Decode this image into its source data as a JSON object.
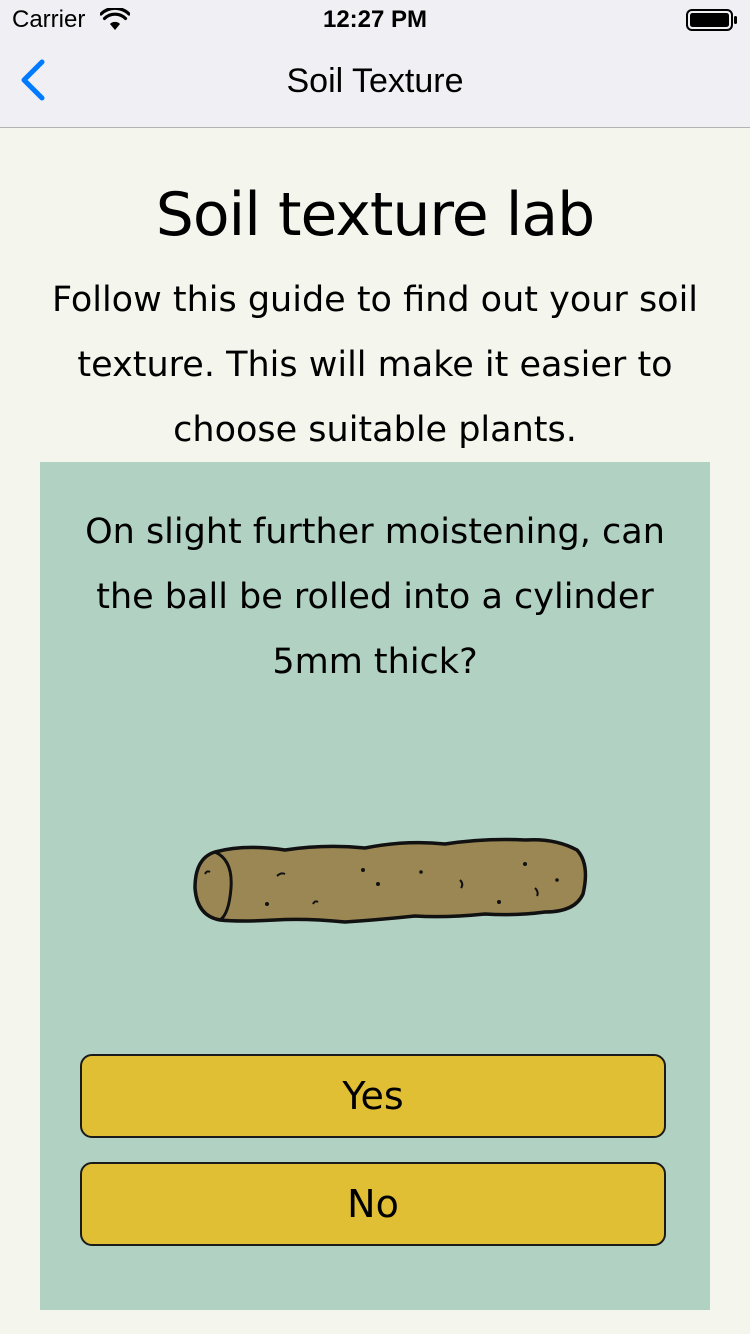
{
  "status_bar": {
    "carrier": "Carrier",
    "time": "12:27 PM",
    "icons": [
      "wifi-icon",
      "battery-icon"
    ]
  },
  "nav": {
    "title": "Soil Texture",
    "back_icon": "chevron-left-icon",
    "accent_color": "#007aff"
  },
  "page": {
    "title": "Soil texture lab",
    "intro": "Follow this guide to find out your soil texture. This will make it easier to choose suitable plants."
  },
  "card": {
    "background_color": "#b1d1c3",
    "question": "On slight further moistening, can the ball be rolled into a cylinder 5mm thick?",
    "illustration_icon": "soil-cylinder-illustration",
    "yes_label": "Yes",
    "no_label": "No",
    "button_color": "#e1bf35"
  }
}
